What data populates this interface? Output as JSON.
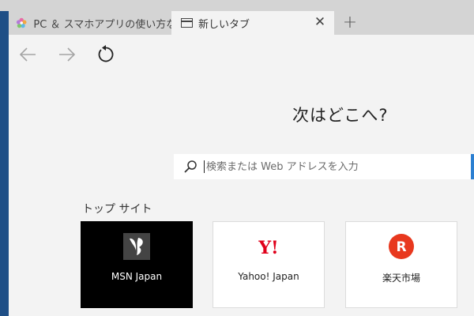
{
  "tabs": [
    {
      "label": "PC ＆ スマホアプリの使い方なら",
      "icon": "flower-favicon-icon"
    },
    {
      "label": "新しいタブ",
      "icon": "page-icon",
      "close_label": "✕"
    }
  ],
  "new_tab_label": "+",
  "toolbar": {
    "back": "arrow-left-icon",
    "forward": "arrow-right-icon",
    "refresh": "refresh-icon"
  },
  "content": {
    "heading": "次はどこへ?",
    "search": {
      "placeholder": "検索または Web アドレスを入力",
      "value": ""
    },
    "top_sites_title": "トップ サイト",
    "top_sites": [
      {
        "label": "MSN Japan",
        "icon": "msn-butterfly-icon"
      },
      {
        "label": "Yahoo! Japan",
        "icon": "yahoo-logo-icon",
        "logo_text": "Y!"
      },
      {
        "label": "楽天市場",
        "icon": "rakuten-logo-icon",
        "logo_text": "R"
      }
    ]
  },
  "colors": {
    "accent": "#2b7fd1",
    "yahoo_red": "#e0001b",
    "rakuten_red": "#e8381e",
    "window_frame": "#1f4f86"
  }
}
